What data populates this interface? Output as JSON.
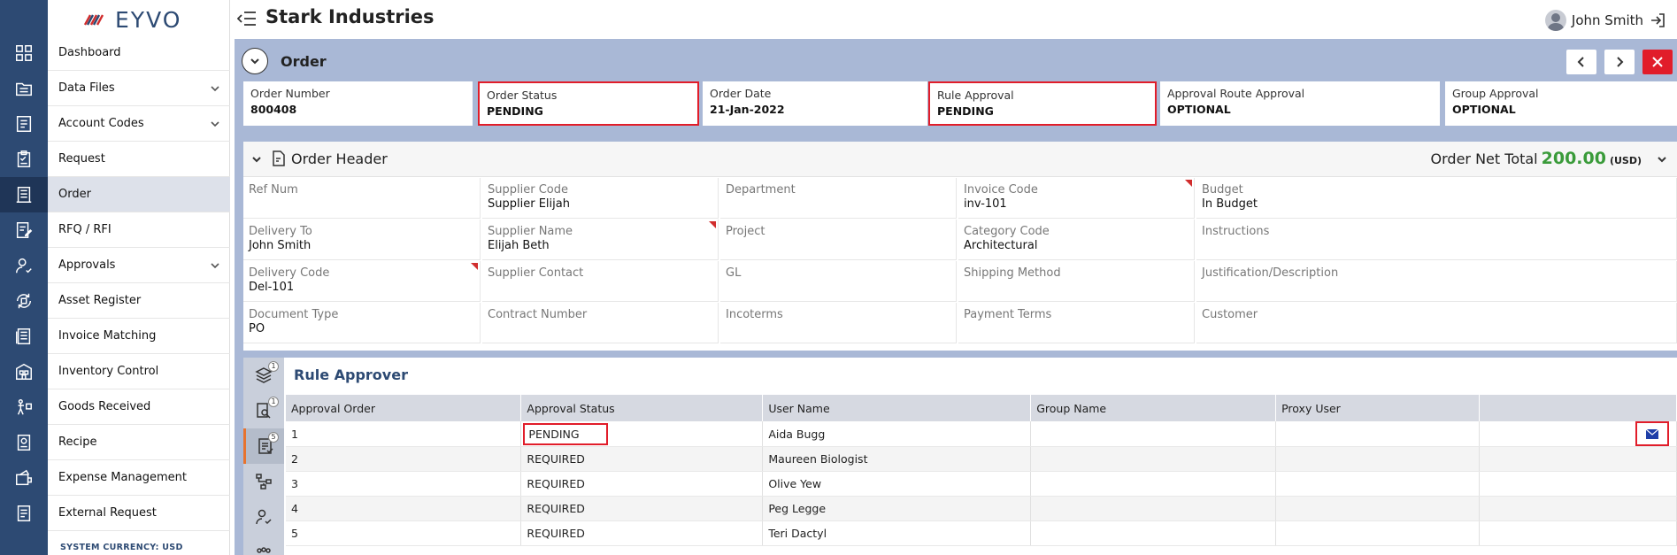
{
  "app": {
    "logo": "EYVO",
    "company": "Stark Industries",
    "user": "John Smith",
    "system_currency": "SYSTEM CURRENCY: USD"
  },
  "sidebar": {
    "items": [
      {
        "label": "Dashboard"
      },
      {
        "label": "Data Files"
      },
      {
        "label": "Account Codes"
      },
      {
        "label": "Request"
      },
      {
        "label": "Order"
      },
      {
        "label": "RFQ / RFI"
      },
      {
        "label": "Approvals"
      },
      {
        "label": "Asset Register"
      },
      {
        "label": "Invoice Matching"
      },
      {
        "label": "Inventory Control"
      },
      {
        "label": "Goods Received"
      },
      {
        "label": "Recipe"
      },
      {
        "label": "Expense Management"
      },
      {
        "label": "External Request"
      }
    ]
  },
  "order": {
    "title": "Order",
    "summary": [
      {
        "label": "Order Number",
        "value": "800408"
      },
      {
        "label": "Order Status",
        "value": "PENDING"
      },
      {
        "label": "Order Date",
        "value": "21-Jan-2022"
      },
      {
        "label": "Rule Approval",
        "value": "PENDING"
      },
      {
        "label": "Approval Route Approval",
        "value": "OPTIONAL"
      },
      {
        "label": "Group Approval",
        "value": "OPTIONAL"
      }
    ]
  },
  "header": {
    "title": "Order Header",
    "net_total_label": "Order Net Total",
    "net_total_value": "200.00",
    "net_total_currency": "(USD)",
    "fields": [
      {
        "label": "Ref Num",
        "value": ""
      },
      {
        "label": "Supplier Code",
        "value": "Supplier Elijah"
      },
      {
        "label": "Department",
        "value": ""
      },
      {
        "label": "Invoice Code",
        "value": "inv-101"
      },
      {
        "label": "Budget",
        "value": "In Budget"
      },
      {
        "label": "Delivery To",
        "value": "John Smith"
      },
      {
        "label": "Supplier Name",
        "value": "Elijah Beth"
      },
      {
        "label": "Project",
        "value": ""
      },
      {
        "label": "Category Code",
        "value": "Architectural"
      },
      {
        "label": "Instructions",
        "value": ""
      },
      {
        "label": "Delivery Code",
        "value": "Del-101"
      },
      {
        "label": "Supplier Contact",
        "value": ""
      },
      {
        "label": "GL",
        "value": ""
      },
      {
        "label": "Shipping Method",
        "value": ""
      },
      {
        "label": "Justification/Description",
        "value": ""
      },
      {
        "label": "Document Type",
        "value": "PO"
      },
      {
        "label": "Contract Number",
        "value": ""
      },
      {
        "label": "Incoterms",
        "value": ""
      },
      {
        "label": "Payment Terms",
        "value": ""
      },
      {
        "label": "Customer",
        "value": ""
      }
    ]
  },
  "tabs": {
    "badges": [
      "1",
      "1",
      "5"
    ]
  },
  "rule_approver": {
    "title": "Rule Approver",
    "columns": [
      "Approval Order",
      "Approval Status",
      "User Name",
      "Group Name",
      "Proxy User"
    ],
    "rows": [
      {
        "order": "1",
        "status": "PENDING",
        "user": "Aida Bugg",
        "group": "",
        "proxy": ""
      },
      {
        "order": "2",
        "status": "REQUIRED",
        "user": "Maureen Biologist",
        "group": "",
        "proxy": ""
      },
      {
        "order": "3",
        "status": "REQUIRED",
        "user": "Olive Yew",
        "group": "",
        "proxy": ""
      },
      {
        "order": "4",
        "status": "REQUIRED",
        "user": "Peg Legge",
        "group": "",
        "proxy": ""
      },
      {
        "order": "5",
        "status": "REQUIRED",
        "user": "Teri Dactyl",
        "group": "",
        "proxy": ""
      }
    ]
  },
  "colors": {
    "rail": "#2d4a73",
    "accent_band": "#a9b8d6",
    "highlight": "#e11d2a",
    "net_total": "#3a9b3a",
    "mail_icon": "#1f3fa8"
  }
}
